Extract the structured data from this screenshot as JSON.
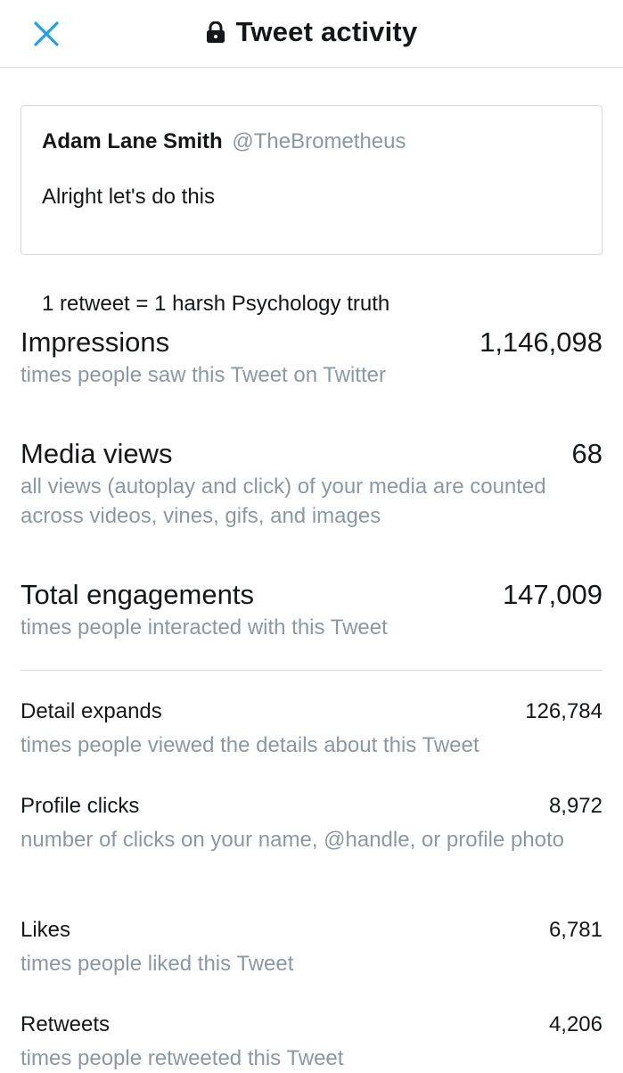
{
  "header": {
    "title": "Tweet activity",
    "close_icon": "close-x-icon",
    "lock_icon": "lock-icon",
    "accent_color": "#1da1f2"
  },
  "tweet": {
    "author_name": "Adam Lane Smith",
    "author_handle": "@TheBrometheus",
    "text_line1": "Alright let's do this",
    "text_line2": "1 retweet = 1 harsh Psychology truth"
  },
  "metrics": [
    {
      "label": "Impressions",
      "value": "1,146,098",
      "description": "times people saw this Tweet on Twitter"
    },
    {
      "label": "Media views",
      "value": "68",
      "description": "all views (autoplay and click) of your media are counted across videos, vines, gifs, and images"
    },
    {
      "label": "Total engagements",
      "value": "147,009",
      "description": "times people interacted with this Tweet"
    }
  ],
  "engagement_breakdown": [
    {
      "label": "Detail expands",
      "value": "126,784",
      "description": "times people viewed the details about this Tweet"
    },
    {
      "label": "Profile clicks",
      "value": "8,972",
      "description": "number of clicks on your name, @handle, or profile photo"
    },
    {
      "label": "Likes",
      "value": "6,781",
      "description": "times people liked this Tweet"
    },
    {
      "label": "Retweets",
      "value": "4,206",
      "description": "times people retweeted this Tweet"
    }
  ]
}
